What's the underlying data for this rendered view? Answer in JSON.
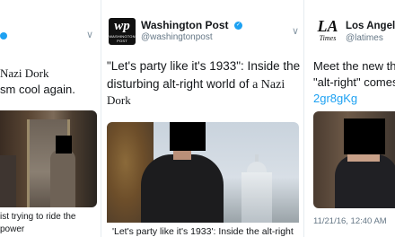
{
  "left_tweet": {
    "text_line1": "Nazi Dork",
    "text_line2": "sm cool again.",
    "caption_line1": "ist trying to ride the",
    "caption_line2": "power"
  },
  "mid_tweet": {
    "logo_mark": "wp",
    "logo_small": "WASHINGTON POST",
    "account_name": "Washington Post",
    "handle": "@washingtonpost",
    "text_line1": "\"Let's party like it's 1933\": Inside the",
    "text_line2_a": "disturbing alt-right world of ",
    "text_line2_b": "a Nazi",
    "text_line3": "Dork",
    "card_caption": "'Let's party like it's 1933': Inside the alt-right"
  },
  "right_tweet": {
    "logo_mark": "LA",
    "logo_small": "Times",
    "account_name": "Los Angeles T",
    "handle": "@latimes",
    "text_line1": "Meet the new thin",
    "text_line2": "\"alt-right\" comes t",
    "link": "2gr8gKg",
    "timestamp": "11/21/16, 12:40 AM"
  },
  "colors": {
    "twitter_blue": "#1da1f2",
    "secondary_text": "#657786",
    "primary_text": "#14171a"
  },
  "icons": {
    "verified": "verified-badge-icon",
    "chevron": "chevron-down-icon"
  }
}
